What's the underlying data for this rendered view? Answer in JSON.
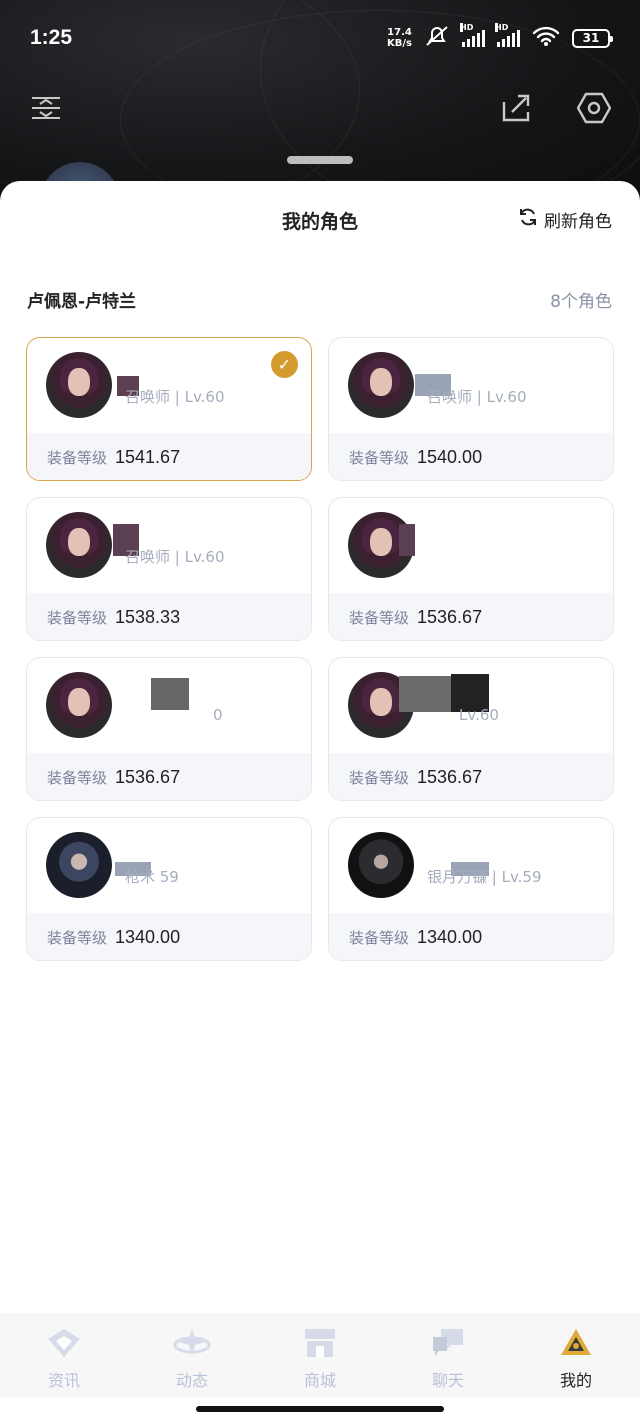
{
  "status_bar": {
    "time": "1:25",
    "net_speed_value": "17.4",
    "net_speed_unit": "KB/s",
    "battery": "31",
    "hd1": "HD",
    "hd2": "HD",
    "wifi_sub": "6"
  },
  "sheet": {
    "title": "我的角色",
    "refresh_label": "刷新角色",
    "server_name": "卢佩恩-卢特兰",
    "role_count": "8个角色"
  },
  "gear_label": "装备等级",
  "characters": [
    {
      "class_level": "召唤师 | Lv.60",
      "gear": "1541.67",
      "selected": true,
      "avatar": "girl"
    },
    {
      "class_level": "召唤师 | Lv.60",
      "gear": "1540.00",
      "selected": false,
      "avatar": "girl"
    },
    {
      "class_level": "召唤师 | Lv.60",
      "gear": "1538.33",
      "selected": false,
      "avatar": "girl"
    },
    {
      "class_level": "",
      "gear": "1536.67",
      "selected": false,
      "avatar": "girl"
    },
    {
      "class_level": "0",
      "gear": "1536.67",
      "selected": false,
      "avatar": "girl"
    },
    {
      "class_level": "Lv.60",
      "gear": "1536.67",
      "selected": false,
      "avatar": "girl"
    },
    {
      "class_level": "枪术  59",
      "gear": "1340.00",
      "selected": false,
      "avatar": "boy"
    },
    {
      "class_level": "银月万镰 | Lv.59",
      "gear": "1340.00",
      "selected": false,
      "avatar": "dark"
    }
  ],
  "tabs": [
    {
      "label": "资讯",
      "icon": "news-icon",
      "active": false
    },
    {
      "label": "动态",
      "icon": "feed-icon",
      "active": false
    },
    {
      "label": "商城",
      "icon": "shop-icon",
      "active": false
    },
    {
      "label": "聊天",
      "icon": "chat-icon",
      "active": false
    },
    {
      "label": "我的",
      "icon": "profile-icon",
      "active": true
    }
  ],
  "colors": {
    "accent": "#d39b2e",
    "muted_text": "#8a93a6",
    "tab_inactive": "#b9c2d6"
  }
}
